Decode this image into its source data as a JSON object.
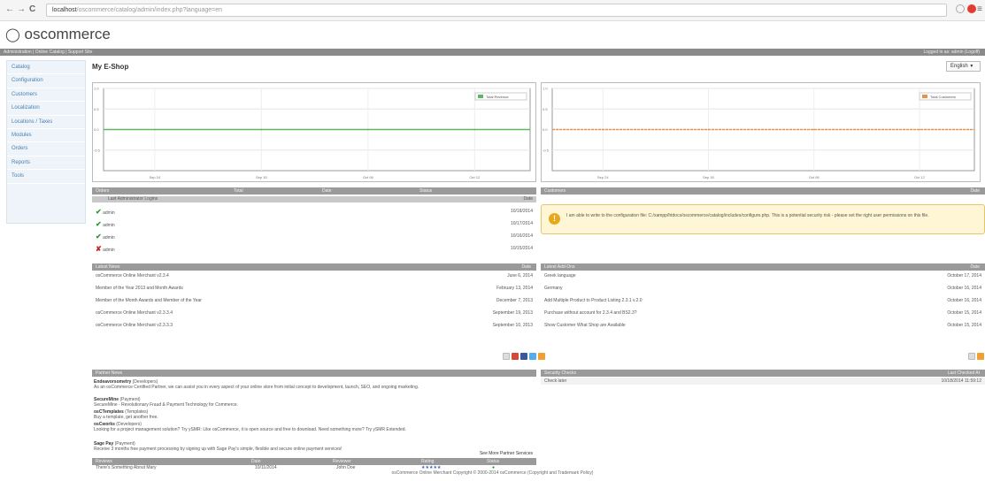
{
  "browser": {
    "back": "←",
    "forward": "→",
    "reload": "C",
    "url_host": "localhost",
    "url_path": "/oscommerce/catalog/admin/index.php?language=en"
  },
  "brand": {
    "logo_text": "oscommerce"
  },
  "topbar": {
    "left": "Administration  |  Online Catalog  |  Support Site",
    "right": "Logged in as: admin (Logoff)"
  },
  "sidebar": {
    "items": [
      {
        "label": "Catalog"
      },
      {
        "label": "Configuration"
      },
      {
        "label": "Customers"
      },
      {
        "label": "Localization"
      },
      {
        "label": "Locations / Taxes"
      },
      {
        "label": "Modules"
      },
      {
        "label": "Orders"
      },
      {
        "label": "Reports"
      },
      {
        "label": "Tools"
      }
    ]
  },
  "page": {
    "title": "My E-Shop",
    "language_select": "English"
  },
  "chart_data": [
    {
      "type": "line",
      "title": "",
      "xlabel": "",
      "ylabel": "",
      "categories": [
        "Sep 24",
        "Sep 30",
        "Oct 06",
        "Oct 12"
      ],
      "series": [
        {
          "name": "Total Revenue",
          "values": [
            0,
            0,
            0,
            0
          ],
          "color": "#5cb85c"
        }
      ],
      "ylim": [
        -1.0,
        1.0
      ],
      "yticks": [
        "1.0",
        "0.5",
        "0.0",
        "-0.5"
      ],
      "grid": true,
      "legend": "top-right"
    },
    {
      "type": "line",
      "title": "",
      "xlabel": "",
      "ylabel": "",
      "categories": [
        "Sep 24",
        "Sep 30",
        "Oct 06",
        "Oct 12"
      ],
      "series": [
        {
          "name": "Total Customers",
          "values": [
            0,
            0,
            0,
            0
          ],
          "color": "#e8934a"
        }
      ],
      "ylim": [
        -1.0,
        1.0
      ],
      "yticks": [
        "1.0",
        "0.5",
        "0.0",
        "-0.5"
      ],
      "grid": true,
      "legend": "top-right"
    }
  ],
  "orders": {
    "headers": [
      "Orders",
      "Total",
      "Date",
      "Status"
    ]
  },
  "logins": {
    "header": "Last Administrator Logins",
    "date_label": "Date",
    "rows": [
      {
        "status": "success",
        "user": "admin",
        "date": "10/18/2014"
      },
      {
        "status": "success",
        "user": "admin",
        "date": "10/17/2014"
      },
      {
        "status": "success",
        "user": "admin",
        "date": "10/16/2014"
      },
      {
        "status": "failed",
        "user": "admin",
        "date": "10/15/2014"
      }
    ]
  },
  "customers": {
    "header": "Customers",
    "date_label": "Date"
  },
  "warning": {
    "icon": "!",
    "text": "I am able to write to the configuration file: C:/xampp/htdocs/oscommerce/catalog/includes/configure.php. This is a potential security risk - please set the right user permissions on this file."
  },
  "news": {
    "header": "Latest News",
    "date_label": "Date",
    "rows": [
      {
        "title": "osCommerce Online Merchant v2.3.4",
        "date": "June 6, 2014"
      },
      {
        "title": "Member of the Year 2013 and Month Awards",
        "date": "February 13, 2014"
      },
      {
        "title": "Member of the Month Awards and Member of the Year",
        "date": "December 7, 2013"
      },
      {
        "title": "osCommerce Online Merchant v2.3.3.4",
        "date": "September 19, 2013"
      },
      {
        "title": "osCommerce Online Merchant v2.3.3.3",
        "date": "September 10, 2013"
      }
    ]
  },
  "addons": {
    "header": "Latest Add-Ons",
    "date_label": "Date",
    "rows": [
      {
        "title": "Greek language",
        "date": "October 17, 2014"
      },
      {
        "title": "Germany",
        "date": "October 16, 2014"
      },
      {
        "title": "Add Multiple Product to Product Listing 2.3.1 v.2.0",
        "date": "October 16, 2014"
      },
      {
        "title": "Purchase without account for 2.3.4 and BS2.3?",
        "date": "October 15, 2014"
      },
      {
        "title": "Show Customer What Shop are Available",
        "date": "October 15, 2014"
      }
    ]
  },
  "partners": {
    "header": "Partner News",
    "items": [
      {
        "name": "Endeavorsometry",
        "tag": "(Developers)",
        "text": "As an osCommerce Certified Partner, we can assist you in every aspect of your online store from initial concept to development, launch, SEO, and ongoing marketing."
      },
      {
        "name": "SecureMine",
        "tag": "(Payment)",
        "text": "SecureMine - Revolutionary Fraud & Payment Technology for Commerce."
      },
      {
        "name": "osCTemplates",
        "tag": "(Templates)",
        "text": "Buy a template, get another free."
      },
      {
        "name": "osCworks",
        "tag": "(Developers)",
        "text": "Looking for a project management solution? Try ySMR: Like osCommerce, it is open source and free to download. Need something more? Try ySMR Extended."
      },
      {
        "name": "Sage Pay",
        "tag": "(Payment)",
        "text": "Receive 3 months free payment processing by signing up with Sage Pay's simple, flexible and secure online payment services!"
      }
    ],
    "more_link": "See More Partner Services"
  },
  "reviews": {
    "headers": [
      "Reviews",
      "Date",
      "Reviewer",
      "Rating",
      "Status"
    ],
    "rows": [
      {
        "title": "There's Something About Mary",
        "date": "10/11/2014",
        "reviewer": "John Doe",
        "rating": "★★★★★",
        "status": "●"
      }
    ]
  },
  "security": {
    "headers": [
      "Security Checks",
      "Last Checked At"
    ],
    "rows": [
      {
        "title": "Check later",
        "date": "10/18/2014 11:59:12"
      }
    ]
  },
  "footer": "osCommerce Online Merchant Copyright © 2000-2014 osCommerce (Copyright and Trademark Policy)"
}
